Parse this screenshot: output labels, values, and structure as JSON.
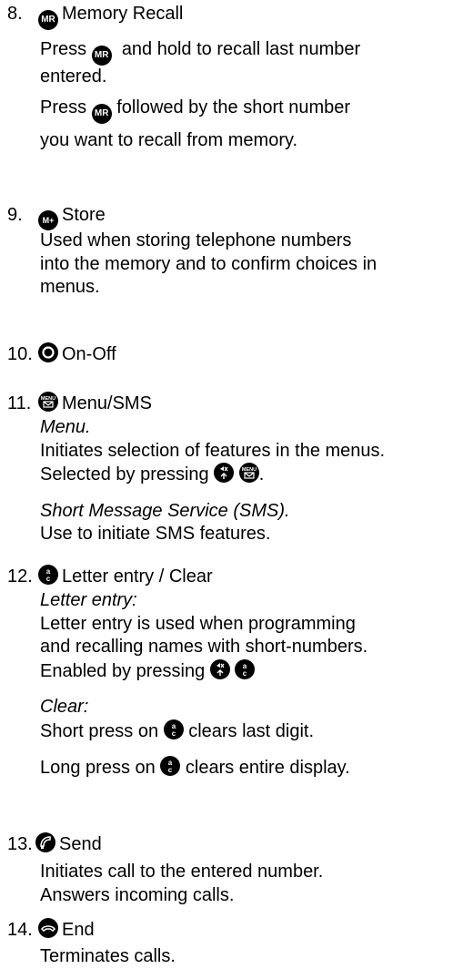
{
  "items": [
    {
      "number": "8.",
      "icon": "mr-key-icon",
      "icon_label": "MR",
      "title": "Memory Recall",
      "para1_a": "Press",
      "para1_b": "and hold to recall last number",
      "para1_c": "entered.",
      "para2_a": "Press",
      "para2_b": "followed by the short number",
      "para2_c": "you want  to recall from memory."
    },
    {
      "number": "9.",
      "icon": "m-plus-key-icon",
      "icon_label": "M+",
      "title": "Store",
      "line1": "Used when storing telephone numbers",
      "line2": "into the memory and to confirm choices in",
      "line3": "menus."
    },
    {
      "number": "10.",
      "icon": "power-key-icon",
      "title": "On-Off"
    },
    {
      "number": "11.",
      "icon": "menu-key-icon",
      "icon_label": "MENU",
      "title": "Menu/SMS",
      "sub1": "Menu.",
      "line1": "Initiates selection of features in the menus.",
      "line2": "Selected by pressing",
      "line2_end": ".",
      "sub2": "Short Message Service (SMS).",
      "line3": "Use to initiate SMS features."
    },
    {
      "number": "12.",
      "icon": "letter-clear-key-icon",
      "icon_label": "a c",
      "title": "Letter entry / Clear",
      "sub1": "Letter entry:",
      "line1": "Letter entry is used when programming",
      "line2": "and recalling names with short-numbers.",
      "line3": "Enabled by pressing",
      "sub2": "Clear:",
      "short_a": "Short press on",
      "short_b": "clears last digit.",
      "long_a": "Long press on",
      "long_b": "clears entire display."
    },
    {
      "number": "13.",
      "icon": "send-key-icon",
      "title": "Send",
      "line1": "Initiates call to the entered number.",
      "line2": "Answers incoming calls."
    },
    {
      "number": "14.",
      "icon": "end-key-icon",
      "title": "End",
      "line1": "Terminates calls."
    }
  ]
}
